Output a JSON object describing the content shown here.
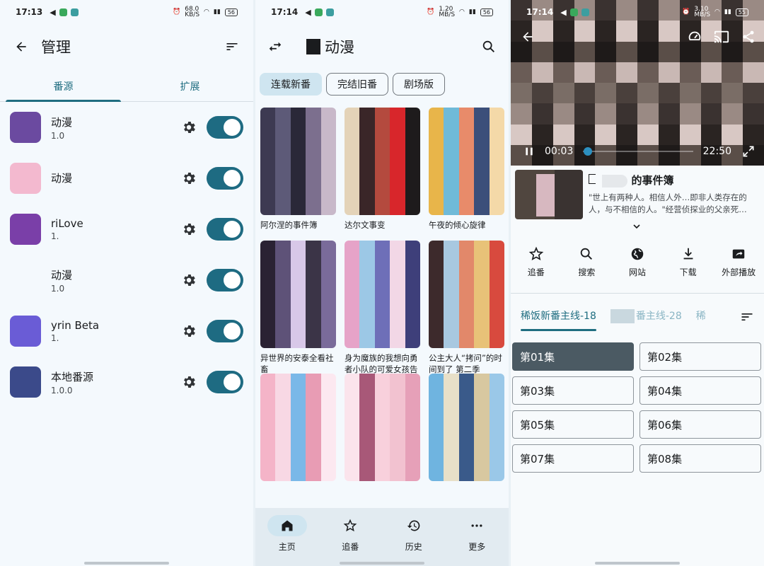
{
  "panel1": {
    "status": {
      "time": "17:13",
      "net_speed": "68.0\nKB/S",
      "battery": "56"
    },
    "title": "管理",
    "tabs": [
      {
        "label": "番源"
      },
      {
        "label": "扩展"
      }
    ],
    "sources": [
      {
        "name": "动漫",
        "version": "1.0",
        "avatar": "#6b4aa0"
      },
      {
        "name": "动漫",
        "version": "",
        "avatar": "#f3b9cf"
      },
      {
        "name": "riLove",
        "version": "1.",
        "avatar": "#7a3fa8"
      },
      {
        "name": "动漫",
        "version": "1.0",
        "avatar": "#f4f9fd"
      },
      {
        "name": "yrin Beta",
        "version": "1.",
        "avatar": "#6a5cd6"
      },
      {
        "name": "本地番源",
        "version": "1.0.0",
        "avatar": "#3b4a8a"
      }
    ]
  },
  "panel2": {
    "status": {
      "time": "17:14",
      "net_speed": "1.20\nMB/S",
      "battery": "56"
    },
    "title": "动漫",
    "chips": [
      {
        "label": "连载新番"
      },
      {
        "label": "完结旧番"
      },
      {
        "label": "剧场版"
      }
    ],
    "cards": [
      {
        "title": "阿尔涅的事件簿",
        "palette": [
          "#3d3a52",
          "#5d5a78",
          "#2a2838",
          "#7c6f8e",
          "#c8b8c9",
          "#d45b8e"
        ]
      },
      {
        "title": "达尔文事变",
        "palette": [
          "#d8262b",
          "#1e1b1c",
          "#7a3535",
          "#e4d3b8",
          "#3a2628",
          "#b44a3e"
        ]
      },
      {
        "title": "午夜的倾心旋律",
        "palette": [
          "#e8b54a",
          "#6fbad8",
          "#e88b6a",
          "#3c4f7a",
          "#f4d9a8",
          "#a26d8f"
        ]
      },
      {
        "title": "异世界的安泰全看社畜",
        "palette": [
          "#3b3447",
          "#7a6b9a",
          "#b8a9d6",
          "#2a2233",
          "#5e5278",
          "#d8c8e8"
        ]
      },
      {
        "title": "身为魔族的我想向勇者小队的可爱女孩告白。",
        "palette": [
          "#e6a3c8",
          "#9cc8e6",
          "#6e6fb8",
          "#f2d7e6",
          "#3e3f7a",
          "#c078a8"
        ]
      },
      {
        "title": "公主大人“拷问”的时间到了 第二季",
        "palette": [
          "#e8c278",
          "#d84a3e",
          "#f4e3c0",
          "#3d2a2c",
          "#a8c8e0",
          "#e2886a"
        ]
      },
      {
        "title": "",
        "palette": [
          "#f4b4c8",
          "#f8d8e4",
          "#7ab8e8",
          "#e89cb4",
          "#fce8f0",
          "#c87898"
        ]
      },
      {
        "title": "",
        "palette": [
          "#f2c2d0",
          "#e6a0b8",
          "#c86890",
          "#fbe4ec",
          "#a85878",
          "#f8d0dc"
        ]
      },
      {
        "title": "",
        "palette": [
          "#6fb4e0",
          "#e8e0c8",
          "#3a5a8a",
          "#d8c8a0",
          "#9ac8e8",
          "#f4ecd8"
        ]
      }
    ],
    "nav": [
      {
        "label": "主页"
      },
      {
        "label": "追番"
      },
      {
        "label": "历史"
      },
      {
        "label": "更多"
      }
    ]
  },
  "panel3": {
    "status": {
      "time": "17:14",
      "net_speed": "3.10\nMB/S",
      "battery": "55"
    },
    "player": {
      "current_time": "00:03",
      "duration": "22:50",
      "progress": 0.0022
    },
    "anime": {
      "title": "的事件簿",
      "description": "\"世上有两种人。相信人外…即非人类存在的人，与不相信的人。\"经营侦探业的父亲死…"
    },
    "actions": [
      {
        "label": "追番"
      },
      {
        "label": "搜索"
      },
      {
        "label": "网站"
      },
      {
        "label": "下载"
      },
      {
        "label": "外部播放"
      }
    ],
    "routes": [
      {
        "label": "稀饭新番主线-18"
      },
      {
        "label": "番主线-28"
      },
      {
        "label": "稀"
      }
    ],
    "episodes": [
      {
        "label": "第01集"
      },
      {
        "label": "第02集"
      },
      {
        "label": "第03集"
      },
      {
        "label": "第04集"
      },
      {
        "label": "第05集"
      },
      {
        "label": "第06集"
      },
      {
        "label": "第07集"
      },
      {
        "label": "第08集"
      }
    ]
  }
}
